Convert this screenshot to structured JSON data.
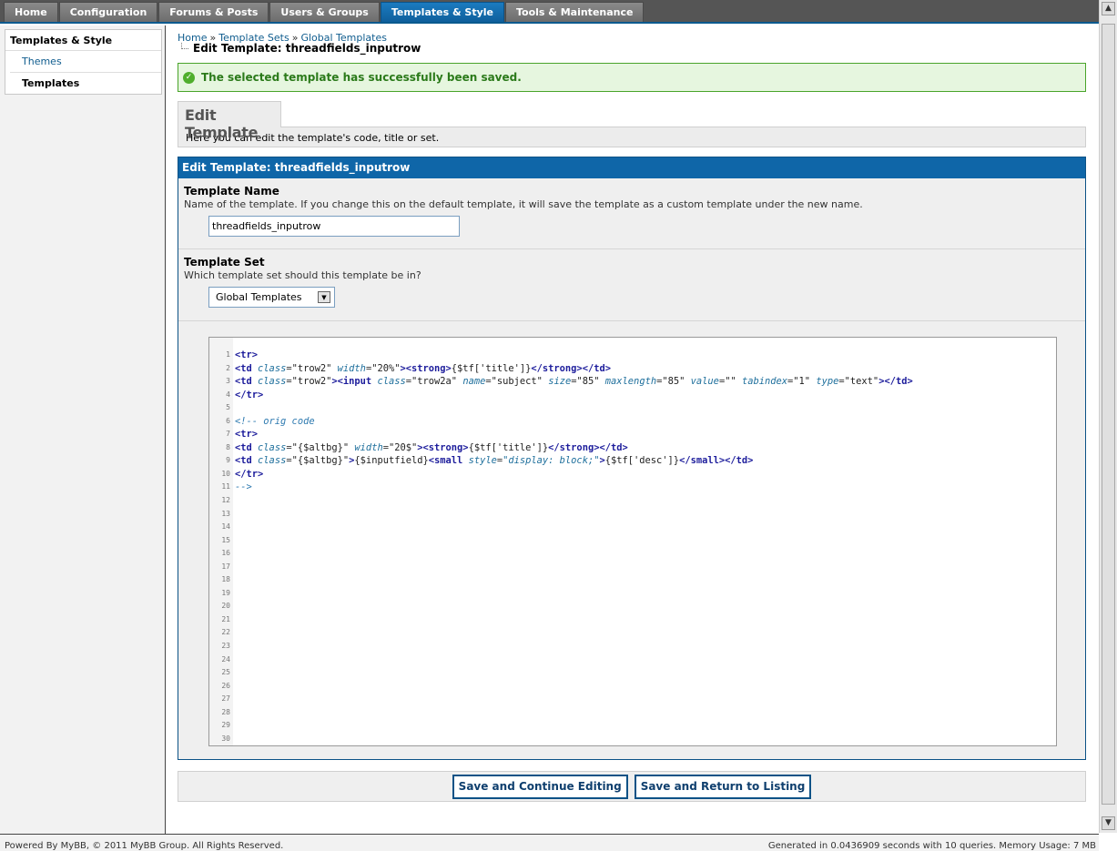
{
  "nav": {
    "tabs": [
      "Home",
      "Configuration",
      "Forums & Posts",
      "Users & Groups",
      "Templates & Style",
      "Tools & Maintenance"
    ],
    "active": "Templates & Style"
  },
  "sidebar": {
    "heading": "Templates & Style",
    "items": [
      "Themes",
      "Templates"
    ]
  },
  "breadcrumb": {
    "home": "Home",
    "sets": "Template Sets",
    "global": "Global Templates",
    "sep": "»",
    "current": "Edit Template: threadfields_inputrow"
  },
  "success_message": "The selected template has successfully been saved.",
  "subtab": {
    "title": "Edit Template",
    "description": "Here you can edit the template's code, title or set."
  },
  "form": {
    "title": "Edit Template: threadfields_inputrow",
    "name_label": "Template Name",
    "name_desc": "Name of the template. If you change this on the default template, it will save the template as a custom template under the new name.",
    "name_value": "threadfields_inputrow",
    "set_label": "Template Set",
    "set_desc": "Which template set should this template be in?",
    "set_value": "Global Templates"
  },
  "editor": {
    "line_count": 30,
    "lines": [
      "<tr>",
      "<td class=\"trow2\" width=\"20%\"><strong>{$tf['title']}</strong></td>",
      "<td class=\"trow2\"><input class=\"trow2a\" name=\"subject\" size=\"85\" maxlength=\"85\" value=\"\" tabindex=\"1\" type=\"text\"></td>",
      "</tr>",
      "",
      "<!-- orig code",
      "<tr>",
      "<td class=\"{$altbg}\" width=\"20$\"><strong>{$tf['title']}</strong></td>",
      "<td class=\"{$altbg}\">{$inputfield}<small style=\"display: block;\">{$tf['desc']}</small></td>",
      "</tr>",
      "-->"
    ]
  },
  "buttons": {
    "save_continue": "Save and Continue Editing",
    "save_return": "Save and Return to Listing"
  },
  "footer": {
    "left": "Powered By MyBB, © 2011 MyBB Group. All Rights Reserved.",
    "right": "Generated in 0.0436909 seconds with 10 queries. Memory Usage: 7 MB"
  }
}
